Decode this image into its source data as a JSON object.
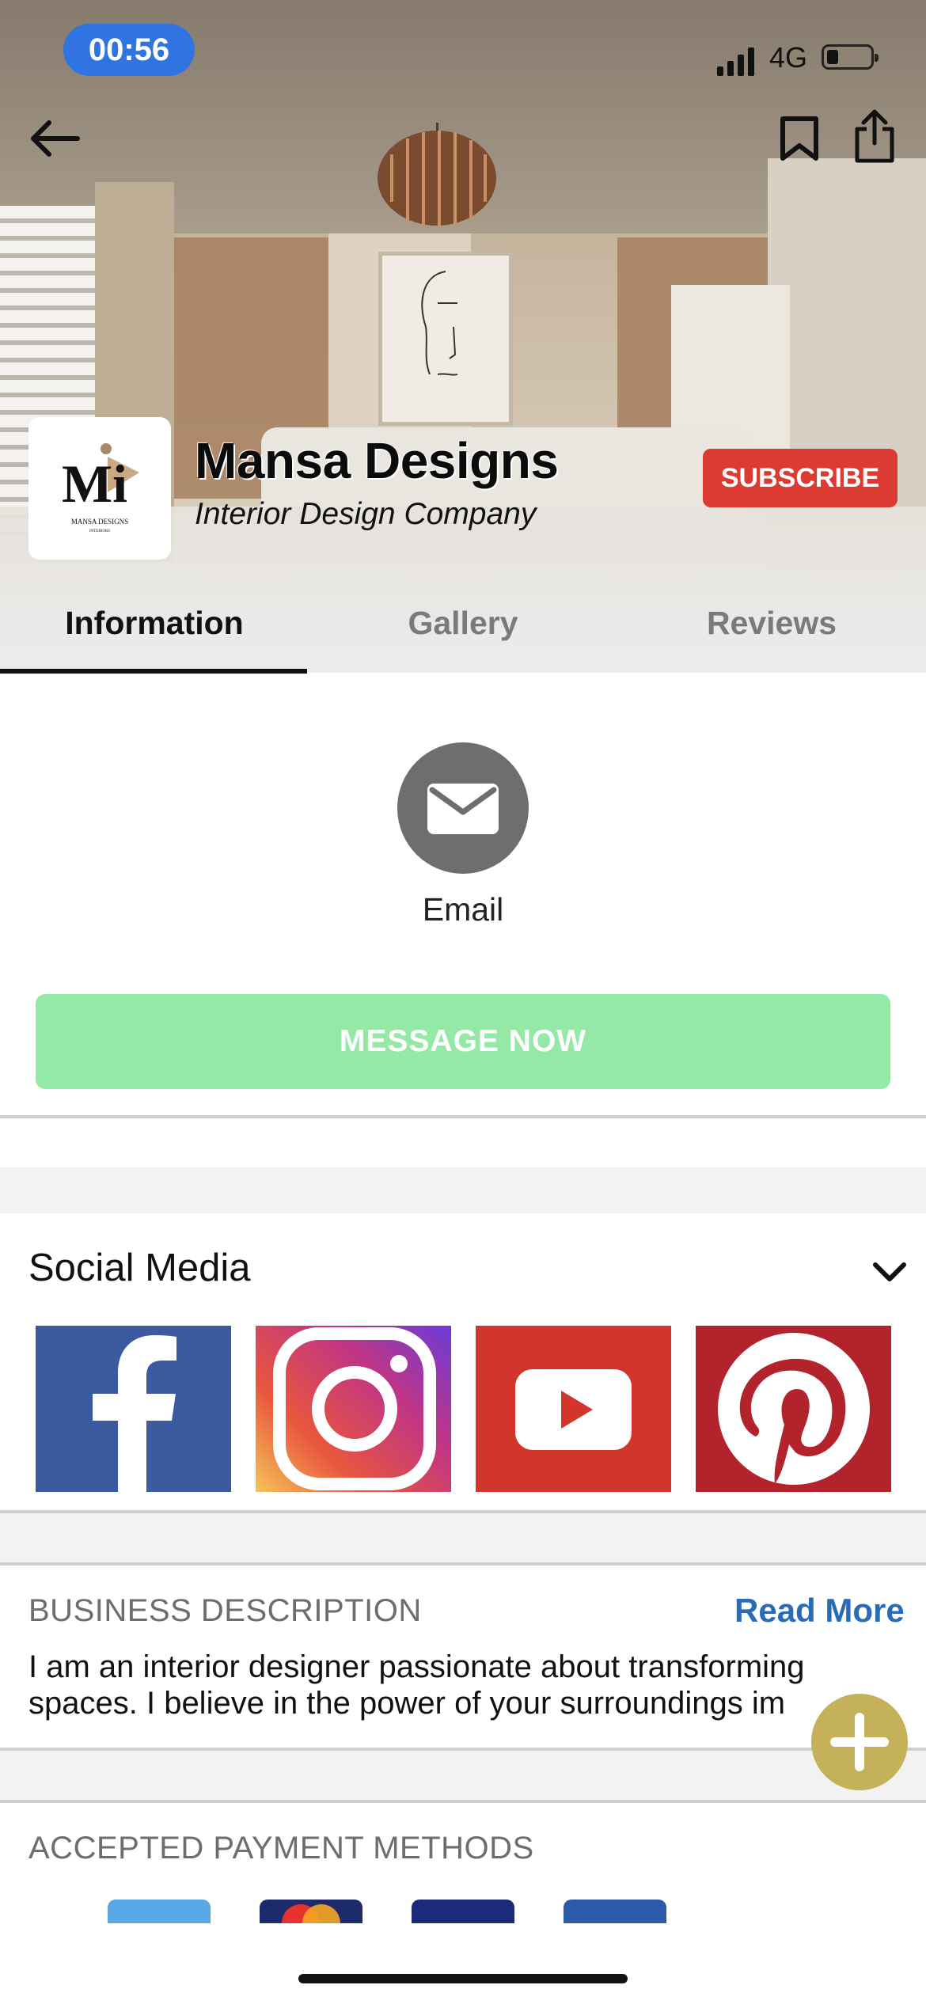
{
  "status_bar": {
    "time": "00:56",
    "network": "4G",
    "time_pill_color": "#2f74e1"
  },
  "header": {
    "business_name": "Mansa Designs",
    "business_subtitle": "Interior Design Company",
    "subscribe_label": "SUBSCRIBE",
    "logo": {
      "monogram": "Mi",
      "wordmark": "MANSA DESIGNS",
      "tagline": "INTERIORS"
    },
    "icons": [
      "back-arrow-icon",
      "bookmark-icon",
      "share-icon"
    ]
  },
  "tabs": [
    {
      "label": "Information",
      "active": true
    },
    {
      "label": "Gallery",
      "active": false
    },
    {
      "label": "Reviews",
      "active": false
    }
  ],
  "contact": {
    "email_label": "Email",
    "message_button": "MESSAGE NOW",
    "message_button_color": "#94e9a6"
  },
  "social": {
    "title": "Social Media",
    "platforms": [
      {
        "name": "facebook",
        "color": "#3c5aa0"
      },
      {
        "name": "instagram",
        "color": "#c13584"
      },
      {
        "name": "youtube",
        "color": "#d2352b"
      },
      {
        "name": "pinterest",
        "color": "#b3232b"
      }
    ]
  },
  "business_description": {
    "title": "BUSINESS DESCRIPTION",
    "read_more": "Read More",
    "text": "I am an interior designer passionate about transforming spaces. I believe in the power of your surroundings im"
  },
  "payment": {
    "title": "ACCEPTED PAYMENT METHODS",
    "methods": [
      "generic-card",
      "mastercard",
      "visa",
      "visa-electron"
    ]
  },
  "colors": {
    "subscribe": "#db3b33",
    "read_more": "#2a6bb8",
    "fab": "#c4b159"
  }
}
